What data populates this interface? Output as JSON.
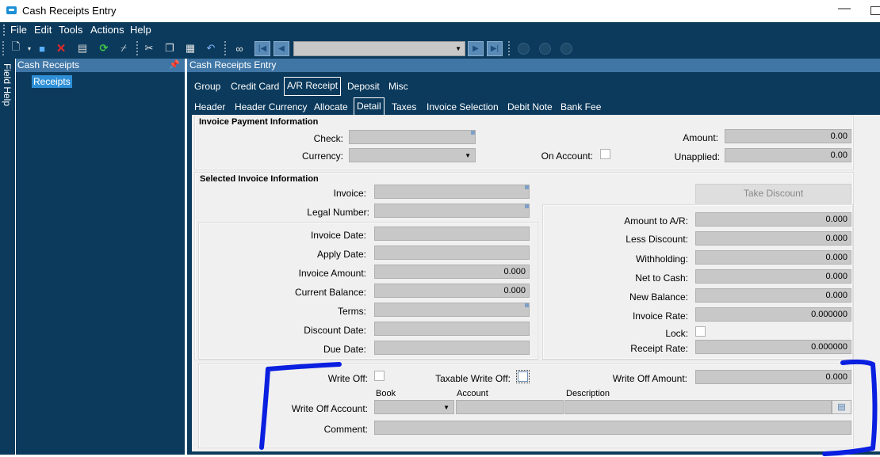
{
  "window": {
    "title": "Cash Receipts Entry"
  },
  "menu": [
    "File",
    "Edit",
    "Tools",
    "Actions",
    "Help"
  ],
  "toolbar": {
    "record_combo_value": ""
  },
  "side": {
    "field_help": "Field Help"
  },
  "tree": {
    "title": "Cash Receipts",
    "node": "Receipts"
  },
  "main": {
    "title": "Cash Receipts Entry"
  },
  "tabs_top": [
    "Group",
    "Credit Card",
    "A/R Receipt",
    "Deposit",
    "Misc"
  ],
  "tabs_sub": [
    "Header",
    "Header Currency",
    "Allocate",
    "Detail",
    "Taxes",
    "Invoice Selection",
    "Debit Note",
    "Bank Fee"
  ],
  "payment": {
    "title": "Invoice Payment Information",
    "check_label": "Check:",
    "check_value": "",
    "currency_label": "Currency:",
    "currency_value": "",
    "on_account_label": "On Account:",
    "amount_label": "Amount:",
    "amount_value": "0.00",
    "unapplied_label": "Unapplied:",
    "unapplied_value": "0.00"
  },
  "selected": {
    "title": "Selected Invoice Information",
    "invoice_label": "Invoice:",
    "legal_number_label": "Legal Number:",
    "invoice_date_label": "Invoice Date:",
    "apply_date_label": "Apply Date:",
    "invoice_amount_label": "Invoice Amount:",
    "invoice_amount_value": "0.000",
    "current_balance_label": "Current Balance:",
    "current_balance_value": "0.000",
    "terms_label": "Terms:",
    "discount_date_label": "Discount Date:",
    "due_date_label": "Due Date:",
    "take_discount": "Take Discount",
    "amount_to_ar_label": "Amount to A/R:",
    "amount_to_ar_value": "0.000",
    "less_discount_label": "Less Discount:",
    "less_discount_value": "0.000",
    "withholding_label": "Withholding:",
    "withholding_value": "0.000",
    "net_to_cash_label": "Net to Cash:",
    "net_to_cash_value": "0.000",
    "new_balance_label": "New Balance:",
    "new_balance_value": "0.000",
    "invoice_rate_label": "Invoice Rate:",
    "invoice_rate_value": "0.000000",
    "lock_label": "Lock:",
    "receipt_rate_label": "Receipt Rate:",
    "receipt_rate_value": "0.000000"
  },
  "writeoff": {
    "write_off_label": "Write Off:",
    "taxable_label": "Taxable Write Off:",
    "amount_label": "Write Off Amount:",
    "amount_value": "0.000",
    "book_head": "Book",
    "account_head": "Account",
    "description_head": "Description",
    "account_label": "Write Off Account:",
    "comment_label": "Comment:"
  },
  "colors": {
    "navy": "#0b3a5c",
    "header_blue": "#3f76a6",
    "annotation": "#0a1fe0"
  }
}
